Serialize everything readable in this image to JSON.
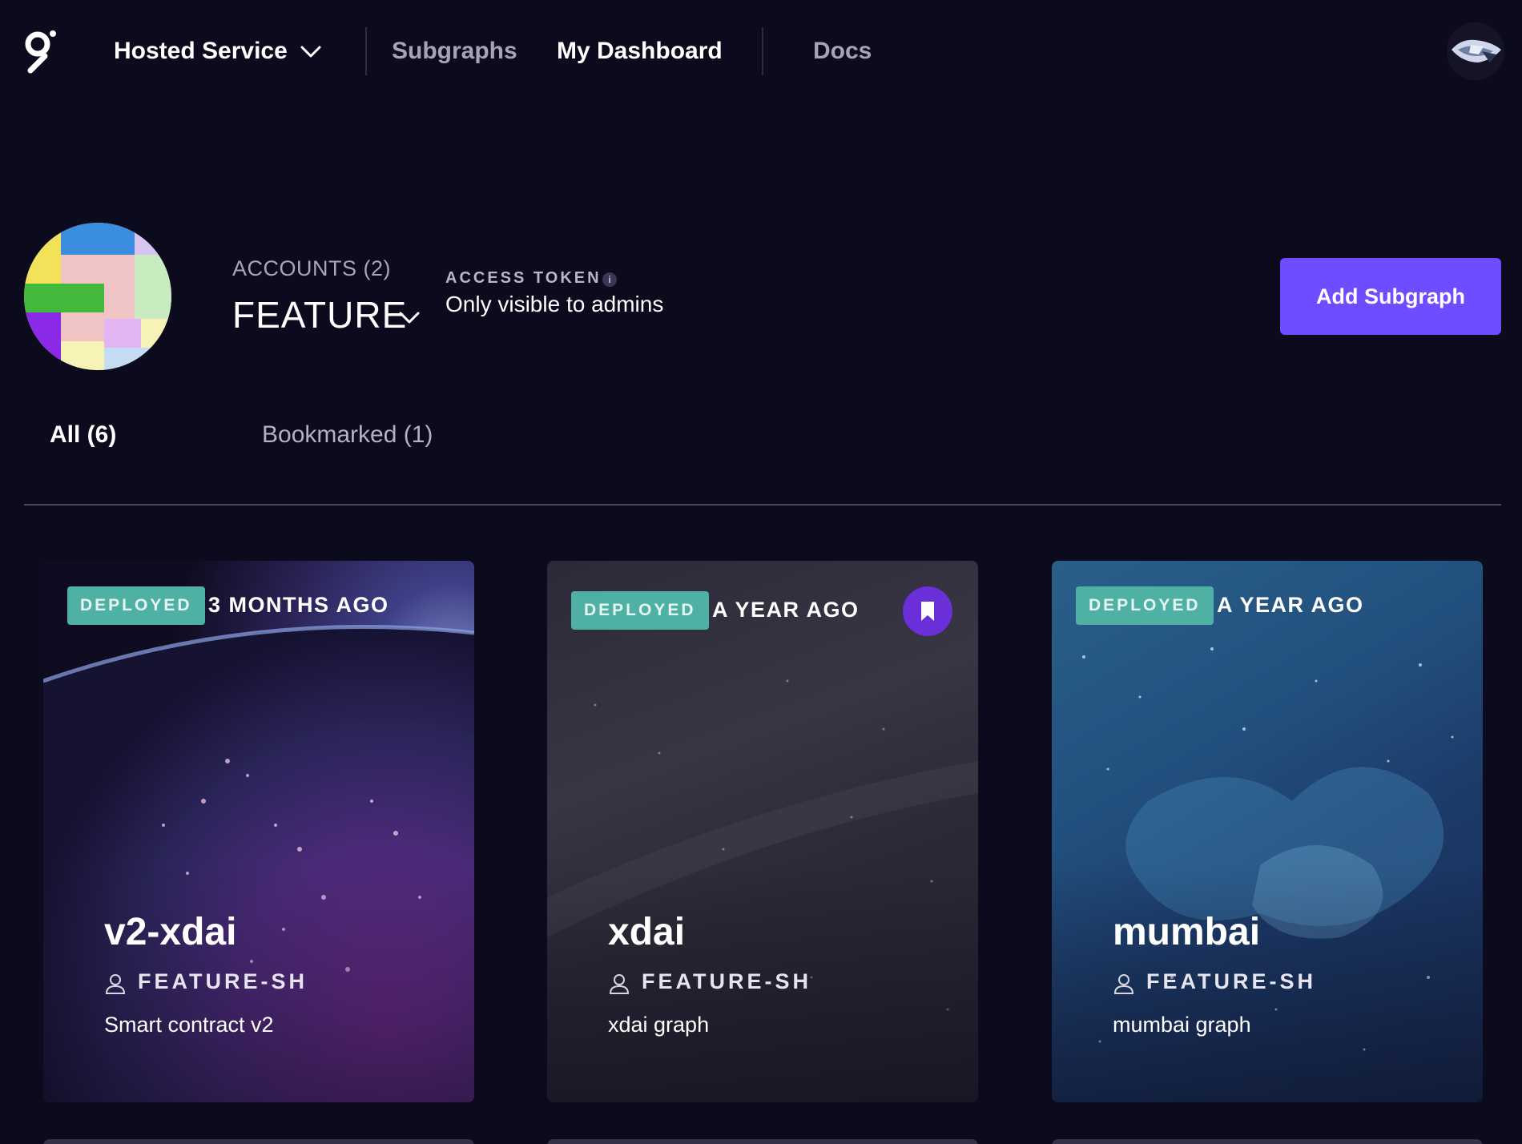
{
  "nav": {
    "hosted_service": "Hosted Service",
    "subgraphs": "Subgraphs",
    "my_dashboard": "My Dashboard",
    "docs": "Docs"
  },
  "account": {
    "accounts_label": "ACCOUNTS (2)",
    "name": "FEATURE",
    "access_token_label": "ACCESS TOKEN",
    "access_token_value": "Only visible to admins",
    "add_subgraph": "Add Subgraph"
  },
  "tabs": {
    "all": "All (6)",
    "bookmarked": "Bookmarked (1)"
  },
  "cards": [
    {
      "status": "DEPLOYED",
      "time": "3 MONTHS AGO",
      "title": "v2-xdai",
      "owner": "FEATURE-SH",
      "description": "Smart contract v2",
      "bookmarked": false
    },
    {
      "status": "DEPLOYED",
      "time": "A YEAR AGO",
      "title": "xdai",
      "owner": "FEATURE-SH",
      "description": "xdai graph",
      "bookmarked": true
    },
    {
      "status": "DEPLOYED",
      "time": "A YEAR AGO",
      "title": "mumbai",
      "owner": "FEATURE-SH",
      "description": "mumbai graph",
      "bookmarked": false
    }
  ],
  "icons": {
    "logo": "graph-logo-icon",
    "dropdown": "chevron-down-icon",
    "info": "info-icon",
    "owner": "user-icon",
    "bookmark": "bookmark-icon"
  },
  "colors": {
    "background": "#0c0a1d",
    "accent": "#6f4cff",
    "deployed_badge": "#4fb0a4",
    "bookmark": "#6a2fd8"
  }
}
